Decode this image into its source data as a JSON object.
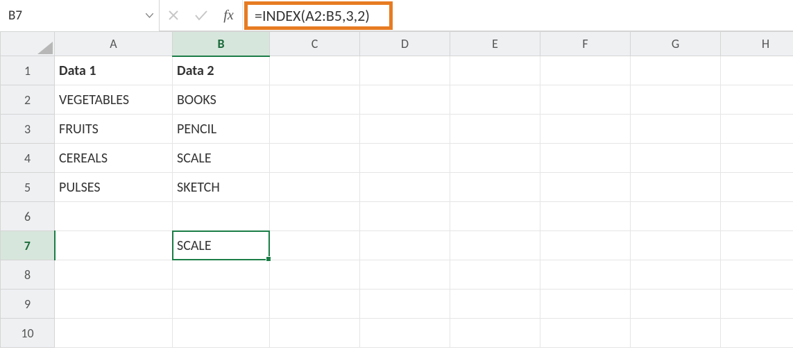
{
  "formula_bar": {
    "name_box": "B7",
    "fx_label": "fx",
    "formula": "=INDEX(A2:B5,3,2)"
  },
  "columns": [
    "A",
    "B",
    "C",
    "D",
    "E",
    "F",
    "G",
    "H"
  ],
  "rows": [
    "1",
    "2",
    "3",
    "4",
    "5",
    "6",
    "7",
    "8",
    "9",
    "10"
  ],
  "active": {
    "col_index": 1,
    "row_index": 6,
    "col": "B",
    "row": "7"
  },
  "cells": {
    "A1": "Data 1",
    "B1": "Data 2",
    "A2": "VEGETABLES",
    "B2": "BOOKS",
    "A3": "FRUITS",
    "B3": "PENCIL",
    "A4": "CEREALS",
    "B4": "SCALE",
    "A5": "PULSES",
    "B5": "SKETCH",
    "B7": "SCALE"
  },
  "bold_cells": [
    "A1",
    "B1"
  ],
  "icons": {
    "cancel": "cancel-icon",
    "enter": "check-icon",
    "fx": "fx-icon",
    "dropdown": "chevron-down-icon"
  }
}
